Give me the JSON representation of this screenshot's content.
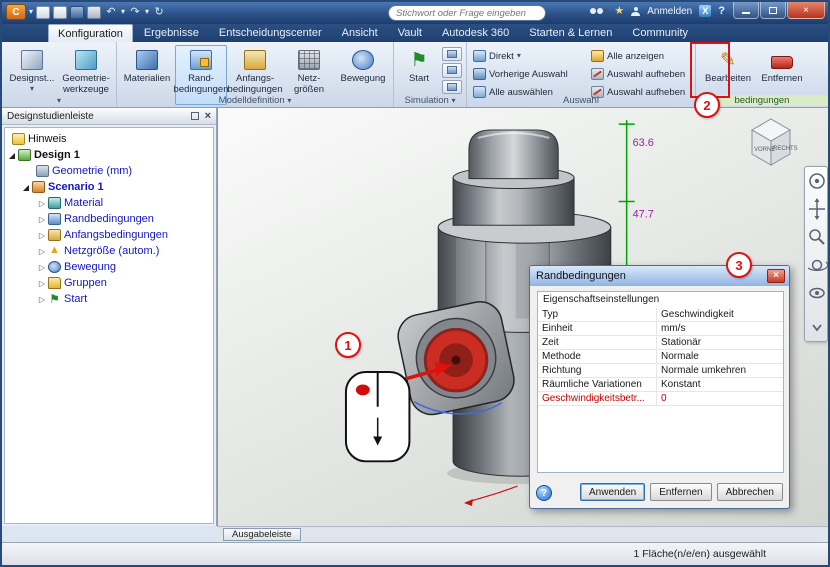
{
  "glyphs": {
    "caret_down": "▾",
    "caret_collapsed": "▷",
    "caret_expanded": "◢",
    "close_x": "×",
    "help": "?",
    "star": "★",
    "undo": "↶",
    "redo": "↷",
    "refresh": "↻",
    "flag": "⚑",
    "pencil": "✎",
    "triangle": "▲"
  },
  "titlebar": {
    "app_initial": "C",
    "search_placeholder": "Stichwort oder Frage eingeben",
    "signin": "Anmelden",
    "exchange": "X"
  },
  "tabs": {
    "items": [
      {
        "label": "Konfiguration"
      },
      {
        "label": "Ergebnisse"
      },
      {
        "label": "Entscheidungscenter"
      },
      {
        "label": "Ansicht"
      },
      {
        "label": "Vault"
      },
      {
        "label": "Autodesk 360"
      },
      {
        "label": "Starten & Lernen"
      },
      {
        "label": "Community"
      }
    ]
  },
  "ribbon": {
    "buttons": {
      "designstudy": "Designst...",
      "geometry1": "Geometrie-",
      "geometry2": "werkzeuge",
      "materials": "Materialien",
      "boundary1": "Rand-",
      "boundary2": "bedingungen",
      "initial1": "Anfangs-",
      "initial2": "bedingungen",
      "mesh1": "Netz-",
      "mesh2": "größen",
      "motion": "Bewegung",
      "start": "Start",
      "direct": "Direkt",
      "show_all": "Alle anzeigen",
      "prev_sel": "Vorherige Auswahl",
      "select_all": "Alle auswählen",
      "deselect_a": "Auswahl aufheben",
      "deselect_b": "Auswahl aufheben",
      "edit": "Bearbeiten",
      "remove": "Entfernen"
    },
    "groups": {
      "model": "Modelldefinition",
      "simulation": "Simulation",
      "selection": "Auswahl",
      "boundary": "bedingungen"
    }
  },
  "tree": {
    "panel_title": "Designstudienleiste",
    "items": [
      {
        "label": "Hinweis"
      },
      {
        "label": "Design 1"
      },
      {
        "label": "Geometrie (mm)"
      },
      {
        "label": "Scenario 1"
      },
      {
        "label": "Material"
      },
      {
        "label": "Randbedingungen"
      },
      {
        "label": "Anfangsbedingungen"
      },
      {
        "label": "Netzgröße (autom.)"
      },
      {
        "label": "Bewegung"
      },
      {
        "label": "Gruppen"
      },
      {
        "label": "Start"
      }
    ]
  },
  "viewport": {
    "dims": {
      "d1": "63.6",
      "d2": "47.7"
    },
    "viewcube": {
      "front": "VORNE",
      "right": "RECHTS"
    }
  },
  "callouts": {
    "one": "1",
    "two": "2",
    "three": "3"
  },
  "dialog": {
    "title": "Randbedingungen",
    "group_title": "Eigenschaftseinstellungen",
    "rows": [
      {
        "name": "Typ",
        "value": "Geschwindigkeit"
      },
      {
        "name": "Einheit",
        "value": "mm/s"
      },
      {
        "name": "Zeit",
        "value": "Stationär"
      },
      {
        "name": "Methode",
        "value": "Normale"
      },
      {
        "name": "Richtung",
        "value": "Normale umkehren"
      },
      {
        "name": "Räumliche Variationen",
        "value": "Konstant"
      },
      {
        "name": "Geschwindigkeitsbetr...",
        "value": "0"
      }
    ],
    "buttons": {
      "apply": "Anwenden",
      "remove": "Entfernen",
      "cancel": "Abbrechen"
    }
  },
  "bottom": {
    "output_bar": "Ausgabeleiste",
    "status": "1 Fläche(n/e/en) ausgewählt"
  }
}
